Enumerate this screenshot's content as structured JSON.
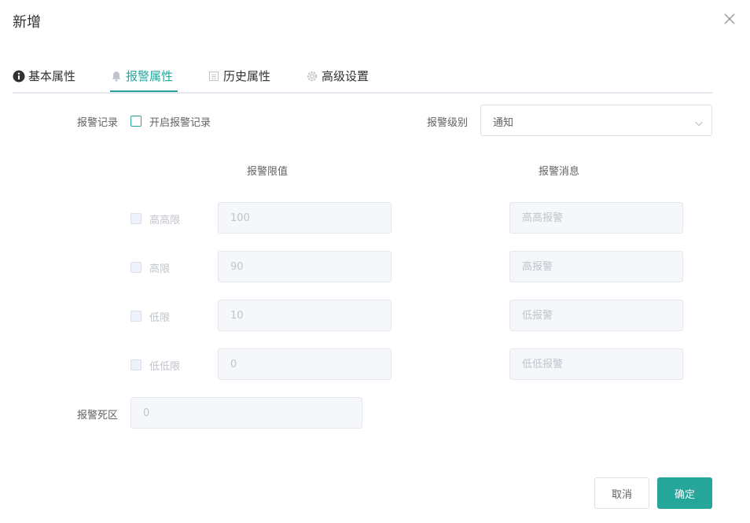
{
  "dialog": {
    "title": "新增"
  },
  "tabs": [
    {
      "label": "基本属性",
      "icon": "info-circle-icon",
      "active": false
    },
    {
      "label": "报警属性",
      "icon": "bell-icon",
      "active": true
    },
    {
      "label": "历史属性",
      "icon": "list-icon",
      "active": false
    },
    {
      "label": "高级设置",
      "icon": "gear-icon",
      "active": false
    }
  ],
  "alarm_record": {
    "label": "报警记录",
    "checkbox_label": "开启报警记录",
    "checked": false
  },
  "alarm_level": {
    "label": "报警级别",
    "value": "通知"
  },
  "columns": {
    "limit": "报警限值",
    "message": "报警消息"
  },
  "limits": [
    {
      "label": "高高限",
      "value": "100",
      "message": "高高报警"
    },
    {
      "label": "高限",
      "value": "90",
      "message": "高报警"
    },
    {
      "label": "低限",
      "value": "10",
      "message": "低报警"
    },
    {
      "label": "低低限",
      "value": "0",
      "message": "低低报警"
    }
  ],
  "deadband": {
    "label": "报警死区",
    "value": "0"
  },
  "footer": {
    "cancel": "取消",
    "confirm": "确定"
  },
  "colors": {
    "accent": "#26a69a",
    "disabled_bg": "#f5f7fa",
    "disabled_text": "#c0c4cc"
  }
}
